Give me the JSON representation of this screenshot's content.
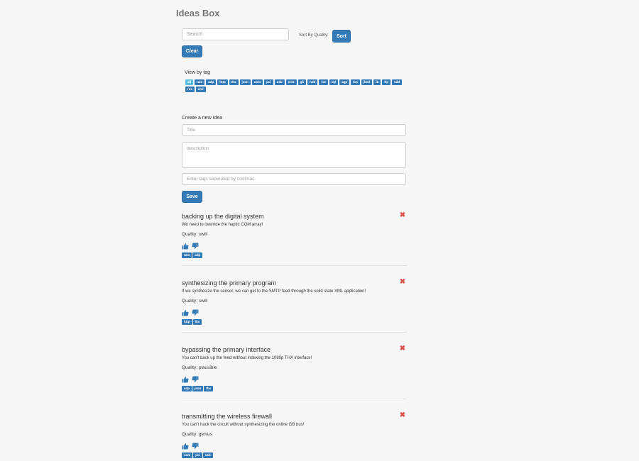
{
  "app": {
    "title": "Ideas Box"
  },
  "controls": {
    "search_placeholder": "Search",
    "sort_label": "Sort By Quality:",
    "sort_button": "Sort",
    "clear_button": "Clear"
  },
  "tag_filter": {
    "label": "View by tag",
    "tags": [
      "all",
      "ram",
      "adp",
      "http",
      "thx",
      "json",
      "com",
      "pci",
      "usb",
      "sms",
      "gb",
      "hdd",
      "ssl",
      "sql",
      "agp",
      "tcp",
      "jbod",
      "ib",
      "ftp",
      "sdd",
      "rss",
      "xml"
    ],
    "active": "all"
  },
  "form": {
    "label": "Create a new Idea",
    "title_placeholder": "Title",
    "description_placeholder": "description",
    "tags_placeholder": "Enter tags seperated by commas",
    "save_button": "Save"
  },
  "ideas": [
    {
      "title": "backing up the digital system",
      "body": "We need to override the haptic COM array!",
      "quality": "Quality: swill",
      "tags": [
        "ram",
        "adp"
      ]
    },
    {
      "title": "synthesizing the primary program",
      "body": "If we synthesize the sensor, we can get to the SMTP feed through the solid state XML application!",
      "quality": "Quality: swill",
      "tags": [
        "http",
        "thx"
      ]
    },
    {
      "title": "bypassing the primary interface",
      "body": "You can't back up the feed without indexing the 1080p THX interface!",
      "quality": "Quality: plausible",
      "tags": [
        "adp",
        "json",
        "thx"
      ]
    },
    {
      "title": "transmitting the wireless firewall",
      "body": "You can't hack the circuit without synthesizing the online GB bus!",
      "quality": "Quality: genius",
      "tags": [
        "com",
        "pci",
        "usb"
      ]
    }
  ],
  "icons": {
    "upvote": "thumbs-up-icon",
    "downvote": "thumbs-down-icon",
    "delete": "close-icon"
  },
  "colors": {
    "primary": "#337ab7",
    "active_tag": "#5bc0de",
    "delete": "#d9534f",
    "background": "#f7f7f7"
  }
}
